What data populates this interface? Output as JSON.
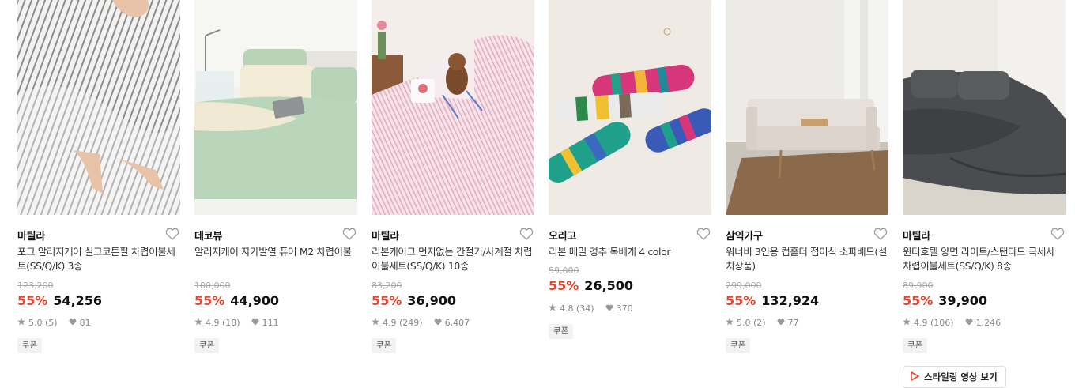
{
  "colors": {
    "discount": "#e8452f",
    "text": "#222222",
    "muted": "#888888"
  },
  "products": [
    {
      "brand": "마틸라",
      "title": "포그 알러지케어 실크코튼필 차렵이불세트(SS/Q/K) 3종",
      "original_price": "123,200",
      "discount": "55%",
      "price": "54,256",
      "rating": "5.0 (5)",
      "likes": "81",
      "coupon": "쿠폰"
    },
    {
      "brand": "데코뷰",
      "title": "알러지케어 자가발열 퓨어 M2 차렵이불",
      "original_price": "100,000",
      "discount": "55%",
      "price": "44,900",
      "rating": "4.9 (18)",
      "likes": "111",
      "coupon": "쿠폰"
    },
    {
      "brand": "마틸라",
      "title": "리본케이크 먼지없는 간절기/사계절 차렵이불세트(SS/Q/K) 10종",
      "original_price": "83,200",
      "discount": "55%",
      "price": "36,900",
      "rating": "4.9 (249)",
      "likes": "6,407",
      "coupon": "쿠폰"
    },
    {
      "brand": "오리고",
      "title": "리본 메밀 경추 목베개 4 color",
      "original_price": "59,000",
      "discount": "55%",
      "price": "26,500",
      "rating": "4.8 (34)",
      "likes": "370",
      "coupon": "쿠폰"
    },
    {
      "brand": "삼익가구",
      "title": "워너비 3인용 컵홀더 접이식 소파베드(설치상품)",
      "original_price": "299,000",
      "discount": "55%",
      "price": "132,924",
      "rating": "5.0 (2)",
      "likes": "77",
      "coupon": "쿠폰"
    },
    {
      "brand": "마틸라",
      "title": "윈터호텔 양면 라이트/스탠다드 극세사 차렵이불세트(SS/Q/K) 8종",
      "original_price": "89,900",
      "discount": "55%",
      "price": "39,900",
      "rating": "4.9 (106)",
      "likes": "1,246",
      "coupon": "쿠폰",
      "video_button": "스타일링 영상 보기"
    }
  ]
}
